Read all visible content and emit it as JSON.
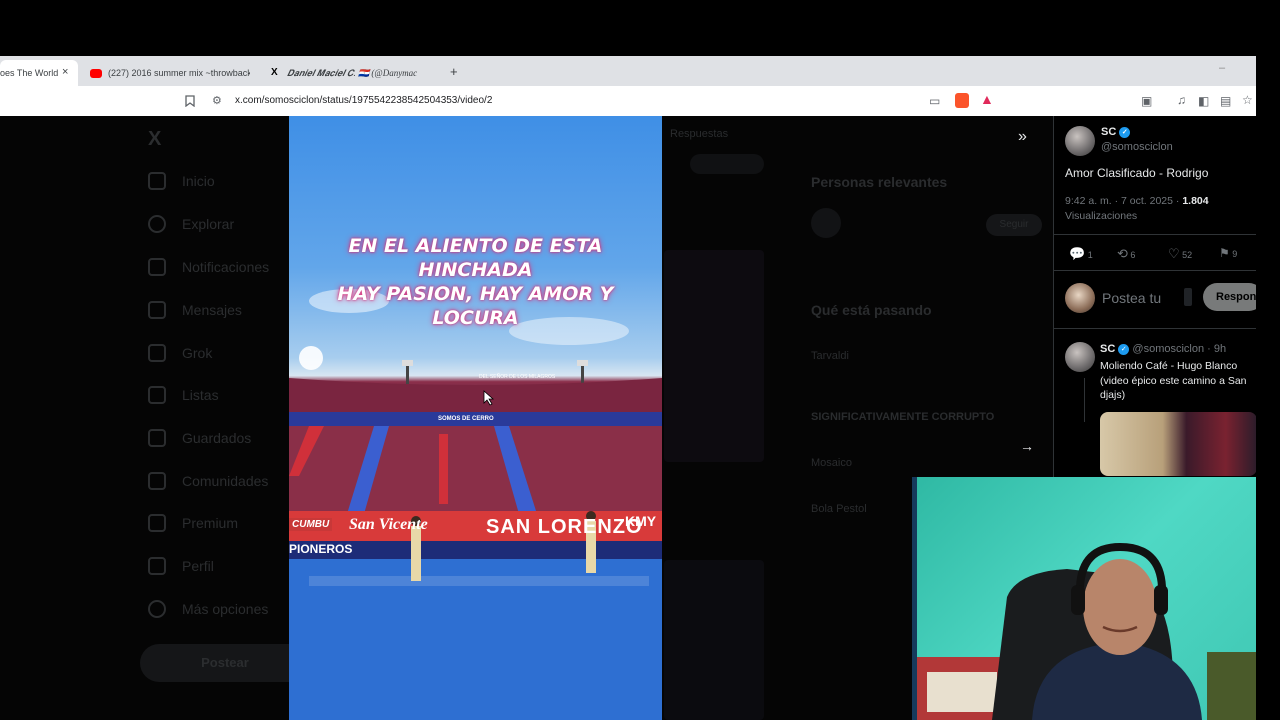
{
  "browser": {
    "tabs": [
      {
        "title": "oes The World",
        "active": true
      },
      {
        "title": "(227) 2016 summer mix ~throwback",
        "active": false
      },
      {
        "title": "𝑫𝒂𝒏𝒊𝒆𝒍 𝑴𝒂𝒄𝒊𝒆𝒍 𝑪. 🇵🇾 (@Danymac",
        "active": false
      }
    ],
    "new_tab_label": "+",
    "close_label": "×",
    "url": "x.com/somosciclon/status/1975542238542504353/video/2",
    "minimize_label": "–"
  },
  "sidebar": {
    "items": [
      "Inicio",
      "Explorar",
      "Notificaciones",
      "Mensajes",
      "Grok",
      "Listas",
      "Guardados",
      "Comunidades",
      "Premium",
      "Perfil",
      "Más opciones"
    ],
    "post_button": "Postear"
  },
  "background": {
    "relevant_people_title": "Personas relevantes",
    "trending_title": "Qué está pasando",
    "trend_1": "Tarvaldi",
    "trend_2": "SIGNIFICATIVAMENTE CORRUPTO",
    "trend_3": "Mosaico",
    "trend_4": "Bola Pestol",
    "follow_button": "Seguir",
    "suggested": "Respuestas"
  },
  "video": {
    "caption_lines": [
      "EN EL ALIENTO DE ESTA HINCHADA",
      "HAY PASION, HAY AMOR Y",
      "LOCURA"
    ],
    "banners": [
      "CUMBU",
      "San Vicente",
      "SAN LORENZO",
      "KMY",
      "PIONEROS",
      "SOMOS DE CERRO",
      "DEL SEÑOR DE LOS MILAGROS"
    ]
  },
  "tweet": {
    "author_name": "SC",
    "author_handle": "@somosciclon",
    "text": "Amor Clasificado - Rodrigo",
    "time": "9:42 a. m. · 7 oct. 2025 · ",
    "views_count": "1.804",
    "views_label": "Visualizaciones",
    "replies": "1",
    "retweets": "6",
    "likes": "52",
    "bookmarks": "9"
  },
  "reply_box": {
    "placeholder": "Postea tu",
    "button": "Respon"
  },
  "reply": {
    "author_name": "SC",
    "author_handle": "@somosciclon · 9h",
    "text_line1": "Moliendo Café - Hugo Blanco",
    "text_line2": "(video épico este camino a San",
    "text_line3": "djajs)"
  },
  "colors": {
    "accent": "#1d9bf0",
    "background": "#000000",
    "chrome": "#dfe1e5"
  }
}
